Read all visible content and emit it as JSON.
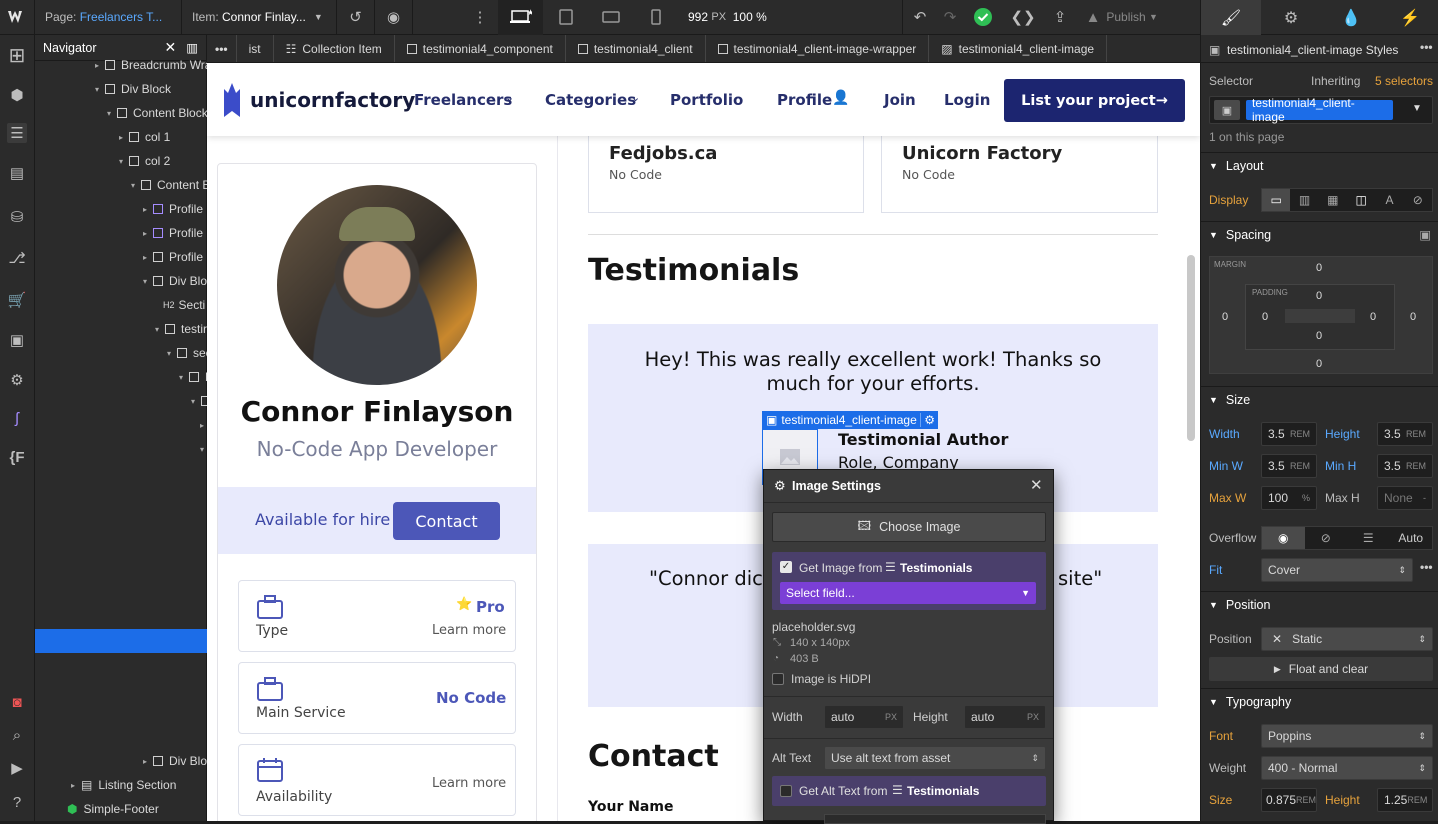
{
  "topbar": {
    "page_label": "Page:",
    "page_name": "Freelancers T...",
    "item_label": "Item:",
    "item_name": "Connor Finlay...",
    "width_value": "992",
    "width_unit": "PX",
    "zoom": "100 %",
    "publish_label": "Publish"
  },
  "navigator": {
    "title": "Navigator",
    "rows": [
      {
        "label": "Breadcrumb Wra"
      },
      {
        "label": "Div Block"
      },
      {
        "label": "Content Block"
      },
      {
        "label": "col 1"
      },
      {
        "label": "col 2"
      },
      {
        "label": "Content B"
      },
      {
        "label": "Profile C"
      },
      {
        "label": "Profile C"
      },
      {
        "label": "Profile C"
      },
      {
        "label": "Div Bloc"
      },
      {
        "label": "Secti"
      },
      {
        "label": "testir"
      },
      {
        "label": "sec"
      },
      {
        "label": "D"
      },
      {
        "label": ""
      },
      {
        "label": "Div Bloc"
      },
      {
        "label": "Listing Section"
      },
      {
        "label": "Simple-Footer"
      }
    ]
  },
  "breadcrumb": {
    "items": [
      {
        "label": "ist"
      },
      {
        "label": "Collection Item"
      },
      {
        "label": "testimonial4_component"
      },
      {
        "label": "testimonial4_client"
      },
      {
        "label": "testimonial4_client-image-wrapper"
      },
      {
        "label": "testimonial4_client-image"
      }
    ]
  },
  "site": {
    "logo_text": "unicornfactory",
    "nav": {
      "freelancers": "Freelancers",
      "categories": "Categories",
      "portfolio": "Portfolio",
      "profile": "Profile",
      "join": "Join",
      "login": "Login",
      "cta": "List your project→"
    },
    "profile": {
      "name": "Connor Finlayson",
      "title": "No-Code App Developer",
      "availability": "Available for hire",
      "contact_button": "Contact",
      "cards": [
        {
          "label": "Type",
          "value": "Pro",
          "link": "Learn more"
        },
        {
          "label": "Main Service",
          "value": "No Code"
        },
        {
          "label": "Availability",
          "link": "Learn more"
        }
      ]
    },
    "jobs": [
      {
        "title": "Fedjobs.ca",
        "tag": "No Code"
      },
      {
        "title": "Unicorn Factory",
        "tag": "No Code"
      }
    ],
    "testimonials_heading": "Testimonials",
    "testimonial1": {
      "quote": "Hey! This was really excellent work! Thanks so much for your efforts.",
      "author": "Testimonial Author",
      "role": "Role, Company"
    },
    "testimonial2": {
      "quote_left": "\"Connor dic",
      "quote_right": "site\""
    },
    "selection_label": "testimonial4_client-image",
    "contact_heading": "Contact",
    "your_name": "Your Name"
  },
  "image_settings": {
    "title": "Image Settings",
    "choose_image": "Choose Image",
    "get_image_from": "Get Image from",
    "collection": "Testimonials",
    "select_field": "Select field...",
    "file_name": "placeholder.svg",
    "dimensions": "140 x 140px",
    "file_size": "403 B",
    "hidpi_label": "Image is HiDPI",
    "width_label": "Width",
    "width_value": "auto",
    "height_label": "Height",
    "height_value": "auto",
    "unit": "PX",
    "alt_label": "Alt Text",
    "alt_value": "Use alt text from asset",
    "get_alt_from": "Get Alt Text from"
  },
  "styles_panel": {
    "title": "testimonial4_client-image Styles",
    "selector_label": "Selector",
    "inheriting_prefix": "Inheriting",
    "inheriting_count": "5 selectors",
    "selector_chip": "testimonial4_client-image",
    "on_page": "1 on this page",
    "layout": {
      "heading": "Layout",
      "display_label": "Display"
    },
    "spacing": {
      "heading": "Spacing",
      "margin_label": "MARGIN",
      "padding_label": "PADDING",
      "margin": {
        "top": "0",
        "right": "0",
        "bottom": "0",
        "left": "0"
      },
      "padding": {
        "top": "0",
        "right": "0",
        "bottom": "0",
        "left": "0"
      }
    },
    "size": {
      "heading": "Size",
      "width_label": "Width",
      "width": "3.5",
      "height_label": "Height",
      "height": "3.5",
      "minw_label": "Min W",
      "minw": "3.5",
      "minh_label": "Min H",
      "minh": "3.5",
      "maxw_label": "Max W",
      "maxw": "100",
      "maxh_label": "Max H",
      "maxh": "None",
      "unit_rem": "REM",
      "unit_pct": "%",
      "overflow_label": "Overflow",
      "overflow_auto": "Auto",
      "fit_label": "Fit",
      "fit_value": "Cover"
    },
    "position": {
      "heading": "Position",
      "position_label": "Position",
      "position_value": "Static",
      "float_clear": "Float and clear"
    },
    "typography": {
      "heading": "Typography",
      "font_label": "Font",
      "font_value": "Poppins",
      "weight_label": "Weight",
      "weight_value": "400 - Normal",
      "size_label": "Size",
      "size_value": "0.875",
      "size_unit": "REM",
      "lh_label": "Height",
      "lh_value": "1.25",
      "lh_unit": "REM"
    }
  },
  "colors": {
    "accent_blue": "#1c6de8",
    "site_navy": "#1c2570",
    "site_indigo": "#4c57b8",
    "testimonial_bg": "#e8eafc",
    "orange_label": "#e6a23c"
  }
}
